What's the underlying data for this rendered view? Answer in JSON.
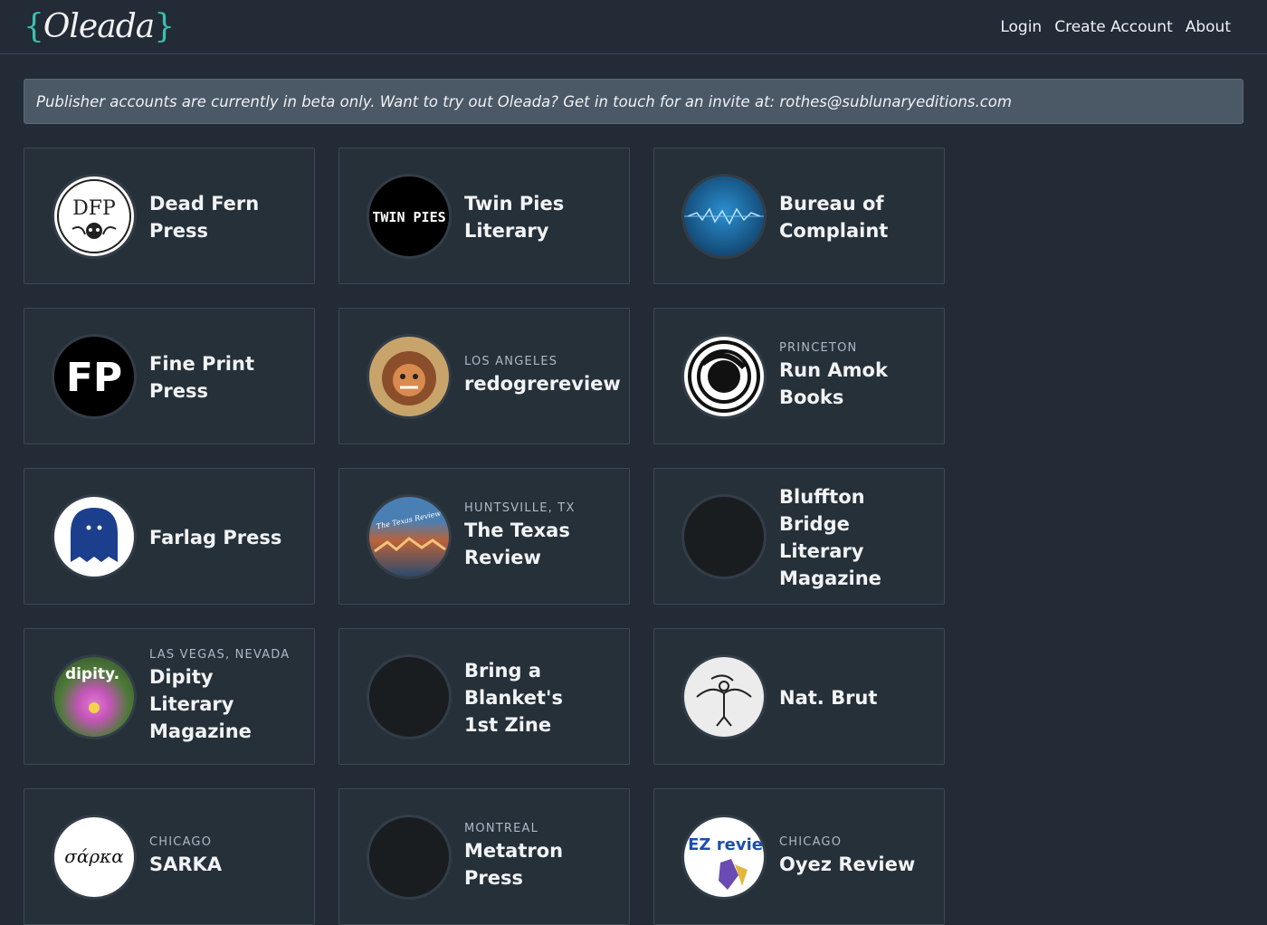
{
  "brand": {
    "logo_text": "Oleada",
    "brace_open": "{",
    "brace_close": "}"
  },
  "nav": {
    "login": "Login",
    "create_account": "Create Account",
    "about": "About"
  },
  "banner": {
    "text": "Publisher accounts are currently in beta only. Want to try out Oleada? Get in touch for an invite at: rothes@sublunaryeditions.com"
  },
  "publishers": [
    {
      "name": "Dead Fern Press",
      "location": "",
      "avatar_text": "DFP",
      "avatar": "dfp-logo-icon"
    },
    {
      "name": "Twin Pies Literary",
      "location": "",
      "avatar_text": "TWIN PIES",
      "avatar": "twin-pies-logo-icon"
    },
    {
      "name": "Bureau of Complaint",
      "location": "",
      "avatar": "waveform-image-icon"
    },
    {
      "name": "Fine Print Press",
      "location": "",
      "avatar_text": "FP",
      "avatar": "fp-logo-icon"
    },
    {
      "name": "redogrereview",
      "location": "LOS ANGELES",
      "avatar": "ogre-illustration-icon"
    },
    {
      "name": "Run Amok Books",
      "location": "PRINCETON",
      "avatar": "swirl-logo-icon"
    },
    {
      "name": "Farlag Press",
      "location": "",
      "avatar": "blue-creature-logo-icon"
    },
    {
      "name": "The Texas Review",
      "location": "HUNTSVILLE, TX",
      "avatar_text": "The Texas Review",
      "avatar": "texas-review-cover-icon"
    },
    {
      "name": "Bluffton Bridge Literary Magazine",
      "location": "",
      "avatar": "dark-placeholder-icon"
    },
    {
      "name": "Dipity Literary Magazine",
      "location": "LAS VEGAS, NEVADA",
      "avatar_text": "dipity.",
      "avatar": "flower-cover-icon"
    },
    {
      "name": "Bring a Blanket's 1st Zine",
      "location": "",
      "avatar": "dark-placeholder-icon"
    },
    {
      "name": "Nat. Brut",
      "location": "",
      "avatar": "winged-figure-sketch-icon"
    },
    {
      "name": "SARKA",
      "location": "CHICAGO",
      "avatar_text": "σάρκα",
      "avatar": "greek-text-logo-icon"
    },
    {
      "name": "Metatron Press",
      "location": "MONTREAL",
      "avatar": "dark-placeholder-icon"
    },
    {
      "name": "Oyez Review",
      "location": "CHICAGO",
      "avatar_text": "OYEZ review",
      "avatar": "oyez-logo-icon"
    }
  ],
  "colors": {
    "background": "#222b36",
    "card": "#263039",
    "banner": "#4b5866",
    "accent": "#3cc0ae"
  }
}
